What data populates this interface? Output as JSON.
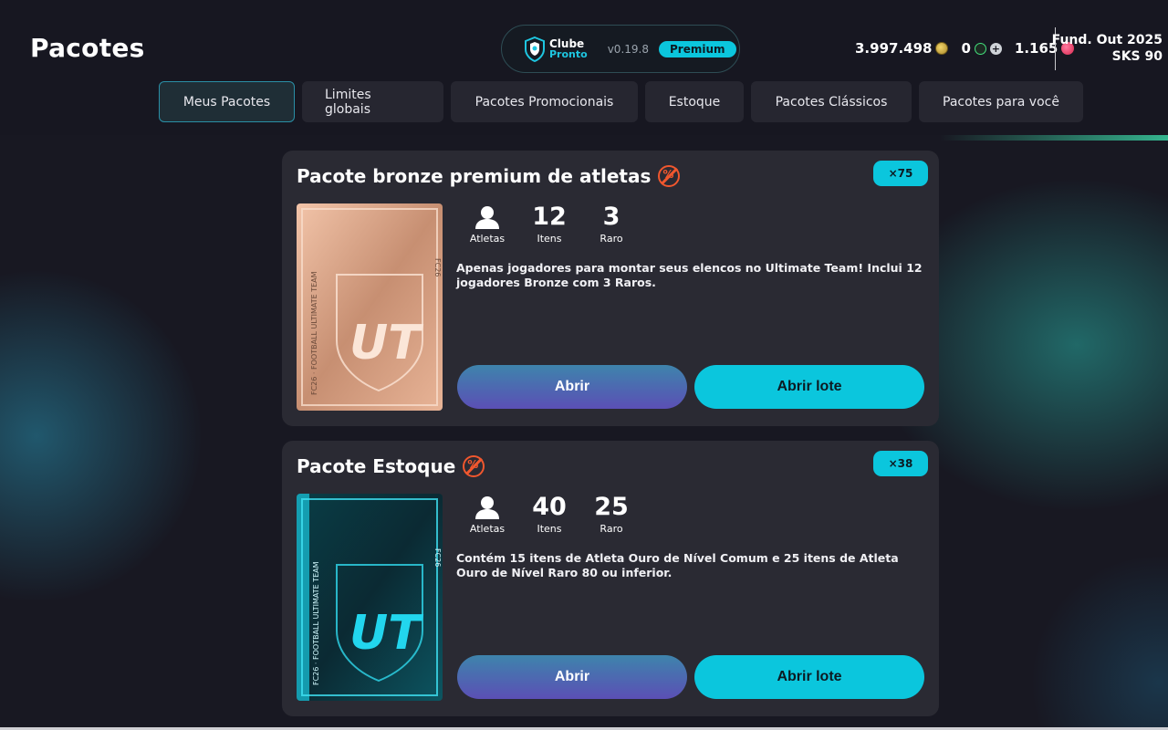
{
  "page": {
    "title": "Pacotes"
  },
  "brand": {
    "logo_word1": "Clube",
    "logo_word2": "Pronto",
    "version": "v0.19.8",
    "badge": "Premium"
  },
  "currencies": {
    "coins": "3.997.498",
    "coins_icon": "gold-coin-icon",
    "points": "0",
    "points_icon": "green-shield-icon",
    "add_icon": "plus-icon",
    "tokens": "1.165",
    "tokens_icon": "red-token-icon"
  },
  "season": {
    "line1": "Fund. Out 2025",
    "line2": "SKS 90"
  },
  "tabs": [
    {
      "label": "Meus Pacotes",
      "active": true
    },
    {
      "label": "Limites globais",
      "active": false
    },
    {
      "label": "Pacotes Promocionais",
      "active": false
    },
    {
      "label": "Estoque",
      "active": false
    },
    {
      "label": "Pacotes Clássicos",
      "active": false
    },
    {
      "label": "Pacotes para você",
      "active": false
    }
  ],
  "packs": [
    {
      "title": "Pacote bronze premium de atletas",
      "count": "×75",
      "icon": "untradeable-icon",
      "stats": [
        {
          "value": "",
          "label": "Atletas",
          "icon": "person-icon"
        },
        {
          "value": "12",
          "label": "Itens"
        },
        {
          "value": "3",
          "label": "Raro"
        }
      ],
      "description": "Apenas jogadores para montar seus elencos no Ultimate Team! Inclui 12 jogadores Bronze com 3 Raros.",
      "open_label": "Abrir",
      "batch_label": "Abrir lote",
      "art": {
        "logo": "UT",
        "side_text": "FC26 · FOOTBALL ULTIMATE TEAM",
        "corner_text": "FC26",
        "color": "#d9a98e"
      }
    },
    {
      "title": "Pacote Estoque",
      "count": "×38",
      "icon": "untradeable-icon",
      "stats": [
        {
          "value": "",
          "label": "Atletas",
          "icon": "person-icon"
        },
        {
          "value": "40",
          "label": "Itens"
        },
        {
          "value": "25",
          "label": "Raro"
        }
      ],
      "description": "Contém 15 itens de Atleta Ouro de Nível Comum e 25 itens de Atleta Ouro de Nível Raro 80 ou inferior.",
      "open_label": "Abrir",
      "batch_label": "Abrir lote",
      "art": {
        "logo": "UT",
        "side_text": "FC26 · FOOTBALL ULTIMATE TEAM",
        "corner_text": "FC26",
        "color": "#18c4dc"
      }
    }
  ]
}
